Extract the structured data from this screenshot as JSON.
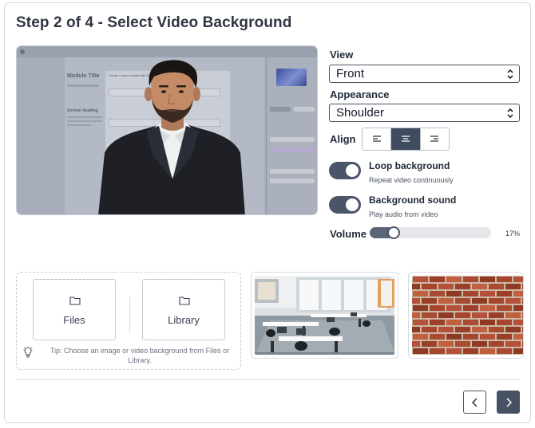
{
  "header": {
    "title": "Step 2 of 4 - Select Video Background"
  },
  "preview": {
    "doc_title": "Module Title",
    "section_heading": "Section heading",
    "modal_text": "Create a new module with AI"
  },
  "controls": {
    "view": {
      "label": "View",
      "value": "Front"
    },
    "appearance": {
      "label": "Appearance",
      "value": "Shoulder"
    },
    "align": {
      "label": "Align",
      "options": [
        "left",
        "center",
        "right"
      ],
      "selected": "center"
    },
    "loop": {
      "title": "Loop background",
      "subtitle": "Repeat video continuously",
      "on": true
    },
    "sound": {
      "title": "Background sound",
      "subtitle": "Play audio from video",
      "on": true
    },
    "volume": {
      "label": "Volume",
      "value_text": "17%",
      "value": 0.17
    }
  },
  "chooser": {
    "files_label": "Files",
    "library_label": "Library",
    "tip": "Tip: Choose an image or video background from Files or Library."
  },
  "backgrounds": [
    {
      "name": "Office interior"
    },
    {
      "name": "Brick wall"
    }
  ],
  "colors": {
    "accent": "#465163",
    "toggle": "#4b5568",
    "border": "#d4d7dc"
  },
  "icons": [
    "chevron-updown-icon",
    "align-left-icon",
    "align-center-icon",
    "align-right-icon",
    "folder-icon",
    "lightbulb-icon",
    "chevron-left-icon",
    "chevron-right-icon"
  ]
}
